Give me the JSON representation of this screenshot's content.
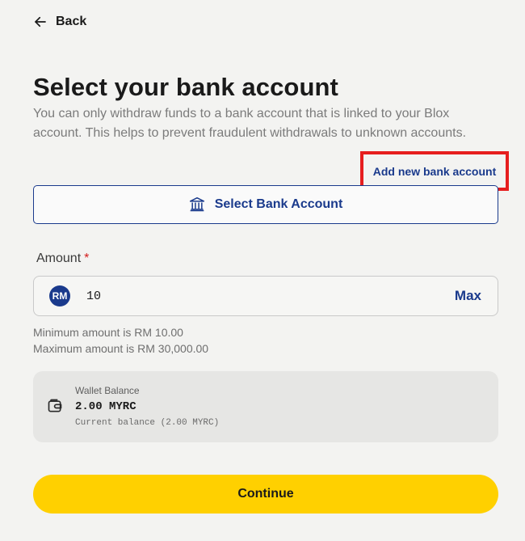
{
  "nav": {
    "back_label": "Back"
  },
  "header": {
    "title": "Select your bank account",
    "subtitle": "You can only withdraw funds to a bank account that is linked to your Blox account. This helps to prevent fraudulent withdrawals to unknown accounts."
  },
  "bank": {
    "add_label": "Add new bank account",
    "select_label": "Select Bank Account"
  },
  "amount": {
    "label": "Amount",
    "required_mark": "*",
    "currency_symbol": "RM",
    "value": "10",
    "max_label": "Max",
    "min_text": "Minimum amount is RM 10.00",
    "max_text": "Maximum amount is RM 30,000.00"
  },
  "wallet": {
    "label": "Wallet Balance",
    "amount": "2.00 MYRC",
    "note": "Current balance (2.00 MYRC)"
  },
  "actions": {
    "continue_label": "Continue"
  },
  "colors": {
    "accent_blue": "#1a3a8c",
    "highlight_red": "#e61e1e",
    "continue_yellow": "#ffd000",
    "background": "#f3f3f1"
  }
}
